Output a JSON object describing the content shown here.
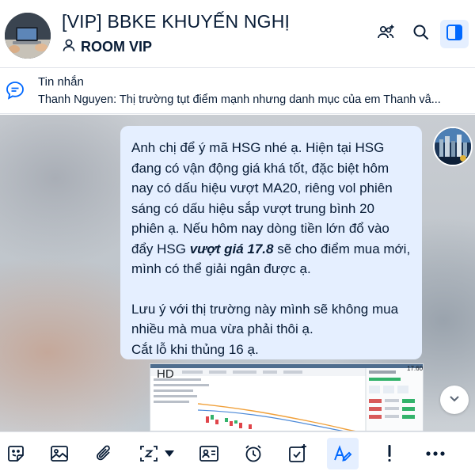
{
  "header": {
    "group_name": "[VIP] BBKE KHUYẾN NGHỊ",
    "room_label": "ROOM VIP",
    "icons": [
      "add-member-icon",
      "search-icon",
      "sidebar-toggle-icon"
    ]
  },
  "pinned": {
    "title": "Tin nhắn",
    "preview": "Thanh Nguyen: Thị trường tụt điểm mạnh nhưng danh mục của em Thanh vẫ..."
  },
  "message": {
    "para1_a": "Anh chị để ý mã HSG nhé ạ. Hiện tại HSG đang có vận động giá khá tốt, đặc biệt hôm nay có dấu hiệu vượt MA20, riêng vol phiên sáng có dấu hiệu sắp vượt trung bình 20 phiên ạ. Nếu hôm nay dòng tiền lớn đổ vào đẩy HSG ",
    "para1_highlight": "vượt giá 17.8",
    "para1_b": " sẽ cho điểm mua mới, mình có thể giải ngân được ạ.",
    "para2": "Lưu ý với thị trường này mình sẽ không mua nhiều mà mua vừa phải thôi ạ.",
    "para3": "Cắt lỗ khi thủng 16 ạ."
  },
  "attachment": {
    "label": "HD",
    "price": "17.60"
  },
  "toolbar": {
    "icons": [
      "sticker-icon",
      "image-icon",
      "attachment-icon",
      "screenshot-icon",
      "dropdown-icon",
      "contact-card-icon",
      "reminder-icon",
      "task-icon",
      "text-format-icon",
      "important-icon",
      "more-icon"
    ]
  },
  "colors": {
    "accent": "#0068ff",
    "bubble": "#e5efff",
    "text": "#081c36"
  }
}
